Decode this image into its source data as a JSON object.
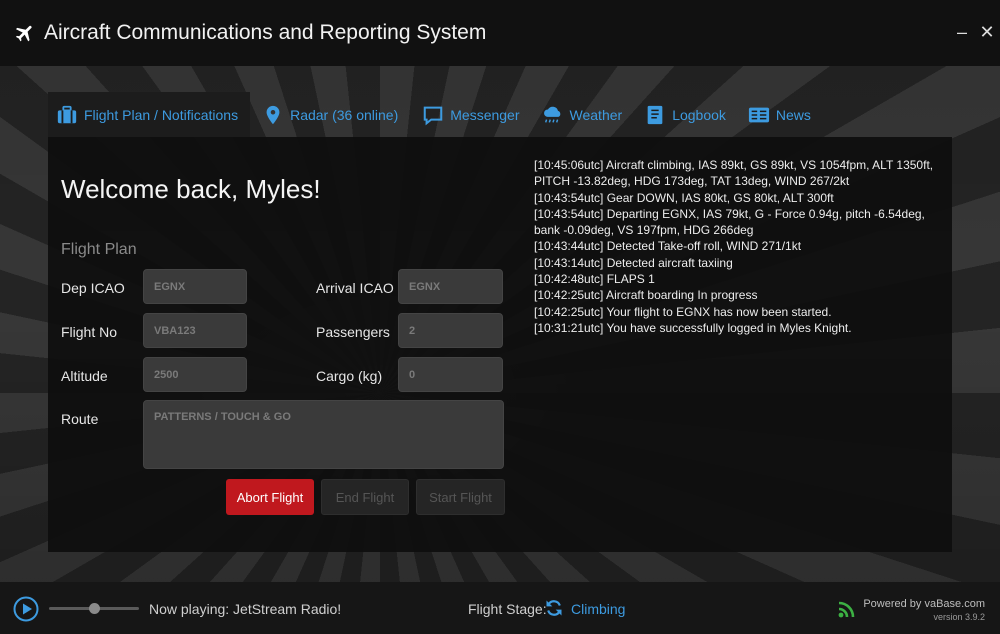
{
  "app": {
    "title": "Aircraft Communications and Reporting System"
  },
  "window": {
    "minimize": "–",
    "close": "✕"
  },
  "tabs": [
    {
      "label": "Flight Plan / Notifications",
      "icon": "suitcase-icon",
      "active": true
    },
    {
      "label": "Radar (36 online)",
      "icon": "map-marker-icon",
      "active": false
    },
    {
      "label": "Messenger",
      "icon": "chat-icon",
      "active": false
    },
    {
      "label": "Weather",
      "icon": "weather-cloud-icon",
      "active": false
    },
    {
      "label": "Logbook",
      "icon": "book-icon",
      "active": false
    },
    {
      "label": "News",
      "icon": "newspaper-icon",
      "active": false
    }
  ],
  "main": {
    "welcome": "Welcome back, Myles!",
    "flight_plan_title": "Flight Plan",
    "fields": {
      "dep_icao": {
        "label": "Dep ICAO",
        "value": "EGNX"
      },
      "arrival_icao": {
        "label": "Arrival ICAO",
        "value": "EGNX"
      },
      "flight_no": {
        "label": "Flight No",
        "value": "VBA123"
      },
      "passengers": {
        "label": "Passengers",
        "value": "2"
      },
      "altitude": {
        "label": "Altitude",
        "value": "2500"
      },
      "cargo": {
        "label": "Cargo (kg)",
        "value": "0"
      },
      "route": {
        "label": "Route",
        "value": "PATTERNS / TOUCH & GO"
      }
    },
    "buttons": {
      "abort": "Abort Flight",
      "end": "End Flight",
      "start": "Start Flight"
    },
    "log": [
      "[10:45:06utc] Aircraft climbing, IAS 89kt, GS 89kt, VS 1054fpm, ALT 1350ft, PITCH -13.82deg, HDG 173deg, TAT 13deg, WIND 267/2kt",
      "[10:43:54utc] Gear DOWN, IAS 80kt, GS 80kt, ALT 300ft",
      "[10:43:54utc] Departing EGNX, IAS 79kt, G - Force 0.94g, pitch -6.54deg, bank -0.09deg, VS 197fpm, HDG 266deg",
      "[10:43:44utc] Detected Take-off roll, WIND 271/1kt",
      "[10:43:14utc] Detected aircraft taxiing",
      "[10:42:48utc] FLAPS 1",
      "[10:42:25utc] Aircraft boarding In progress",
      "[10:42:25utc] Your flight to EGNX has now been started.",
      "[10:31:21utc] You have successfully logged in Myles Knight."
    ]
  },
  "footer": {
    "now_playing": "Now playing: JetStream Radio!",
    "volume_level": 0.5,
    "flight_stage_label": "Flight Stage:",
    "flight_stage_value": "Climbing",
    "powered_by": "Powered by vaBase.com",
    "version": "version 3.9.2"
  },
  "colors": {
    "accent": "#3d9be0",
    "abort": "#c0181e",
    "signal": "#3cb043"
  }
}
